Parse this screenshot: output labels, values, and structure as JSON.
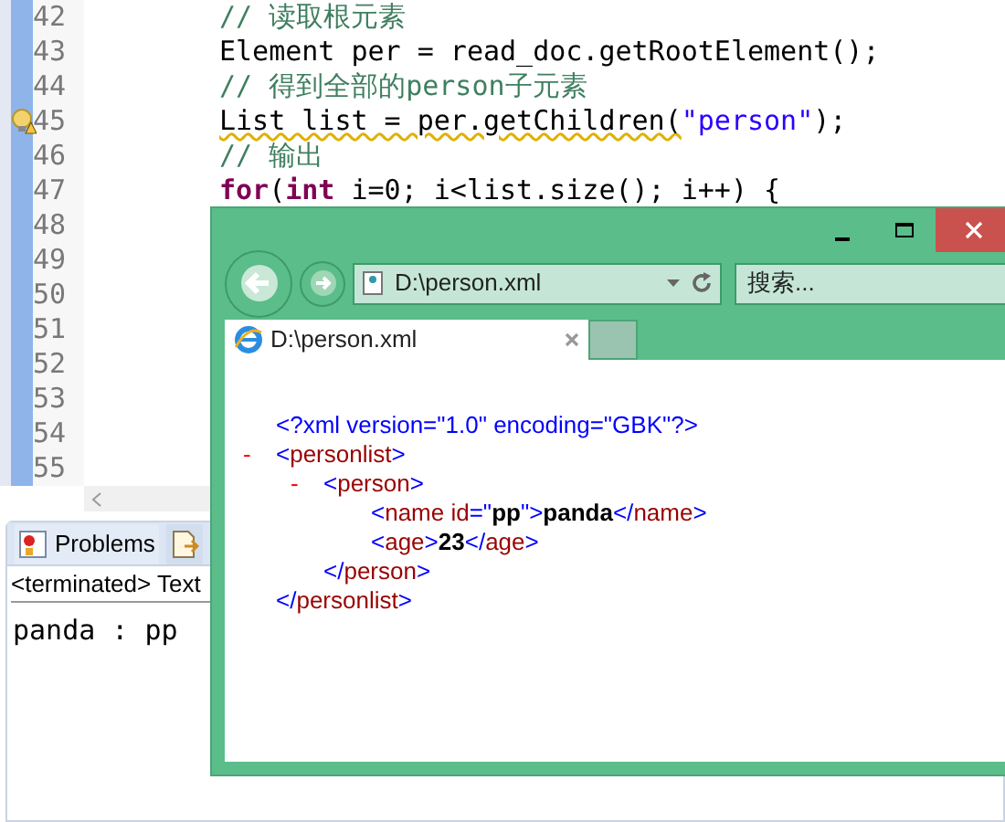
{
  "editor": {
    "lines": [
      {
        "number": "42",
        "warning": false,
        "tokens": [
          {
            "kind": "comment",
            "text": "// 读取根元素"
          }
        ]
      },
      {
        "number": "43",
        "warning": false,
        "tokens": [
          {
            "kind": "plain",
            "text": "Element per = read_doc.getRootElement();"
          }
        ]
      },
      {
        "number": "44",
        "warning": false,
        "tokens": [
          {
            "kind": "comment",
            "text": "// 得到全部的person子元素"
          }
        ]
      },
      {
        "number": "45",
        "warning": true,
        "tokens": [
          {
            "kind": "plain",
            "text": "List list = per.getChildren("
          },
          {
            "kind": "string",
            "text": "\"person\""
          },
          {
            "kind": "plain",
            "text": ");"
          }
        ]
      },
      {
        "number": "46",
        "warning": false,
        "tokens": [
          {
            "kind": "comment",
            "text": "// 输出"
          }
        ]
      },
      {
        "number": "47",
        "warning": false,
        "tokens": [
          {
            "kind": "keyword",
            "text": "for"
          },
          {
            "kind": "plain",
            "text": "("
          },
          {
            "kind": "keyword",
            "text": "int"
          },
          {
            "kind": "plain",
            "text": " i=0; i<list.size(); i++) {"
          }
        ]
      },
      {
        "number": "48",
        "warning": false
      },
      {
        "number": "49",
        "warning": false
      },
      {
        "number": "50",
        "warning": false
      },
      {
        "number": "51",
        "warning": false
      },
      {
        "number": "52",
        "warning": false
      },
      {
        "number": "53",
        "warning": false
      },
      {
        "number": "54",
        "warning": false
      },
      {
        "number": "55",
        "warning": false
      }
    ]
  },
  "bottom_panel": {
    "tabs": [
      {
        "label": "Problems",
        "selected": true
      },
      {
        "selected": false
      }
    ],
    "console_header": "<terminated> Text",
    "console_output": "panda : pp"
  },
  "browser": {
    "address": "D:\\person.xml",
    "search_placeholder": "搜索...",
    "tab_title": "D:\\person.xml",
    "xml": [
      {
        "kind": "leaf",
        "tokens": [
          {
            "kind": "markup",
            "text": "<?xml version=\"1.0\" encoding=\"GBK\"?>"
          }
        ]
      },
      {
        "kind": "element",
        "toggle": "-",
        "open": [
          {
            "kind": "markup",
            "text": "<"
          },
          {
            "kind": "tag",
            "text": "personlist"
          },
          {
            "kind": "markup",
            "text": ">"
          }
        ],
        "children": [
          {
            "kind": "element",
            "toggle": "-",
            "open": [
              {
                "kind": "markup",
                "text": "<"
              },
              {
                "kind": "tag",
                "text": "person"
              },
              {
                "kind": "markup",
                "text": ">"
              }
            ],
            "children": [
              {
                "kind": "leaf",
                "tokens": [
                  {
                    "kind": "markup",
                    "text": "<"
                  },
                  {
                    "kind": "tag",
                    "text": "name id"
                  },
                  {
                    "kind": "markup",
                    "text": "=\""
                  },
                  {
                    "kind": "value",
                    "text": "pp"
                  },
                  {
                    "kind": "markup",
                    "text": "\">"
                  },
                  {
                    "kind": "value",
                    "text": "panda"
                  },
                  {
                    "kind": "markup",
                    "text": "</"
                  },
                  {
                    "kind": "tag",
                    "text": "name"
                  },
                  {
                    "kind": "markup",
                    "text": ">"
                  }
                ]
              },
              {
                "kind": "leaf",
                "tokens": [
                  {
                    "kind": "markup",
                    "text": "<"
                  },
                  {
                    "kind": "tag",
                    "text": "age"
                  },
                  {
                    "kind": "markup",
                    "text": ">"
                  },
                  {
                    "kind": "value",
                    "text": "23"
                  },
                  {
                    "kind": "markup",
                    "text": "</"
                  },
                  {
                    "kind": "tag",
                    "text": "age"
                  },
                  {
                    "kind": "markup",
                    "text": ">"
                  }
                ]
              }
            ],
            "close": [
              {
                "kind": "markup",
                "text": "</"
              },
              {
                "kind": "tag",
                "text": "person"
              },
              {
                "kind": "markup",
                "text": ">"
              }
            ]
          }
        ],
        "close": [
          {
            "kind": "markup",
            "text": "</"
          },
          {
            "kind": "tag",
            "text": "personlist"
          },
          {
            "kind": "markup",
            "text": ">"
          }
        ]
      }
    ]
  }
}
